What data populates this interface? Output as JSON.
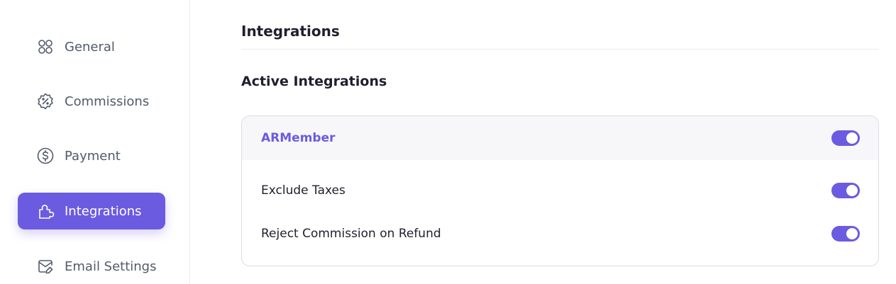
{
  "sidebar": {
    "items": [
      {
        "label": "General",
        "icon": "grid-circles-icon",
        "active": false
      },
      {
        "label": "Commissions",
        "icon": "percent-badge-icon",
        "active": false
      },
      {
        "label": "Payment",
        "icon": "dollar-circle-icon",
        "active": false
      },
      {
        "label": "Integrations",
        "icon": "puzzle-icon",
        "active": true
      },
      {
        "label": "Email Settings",
        "icon": "mail-edit-icon",
        "active": false
      }
    ]
  },
  "main": {
    "title": "Integrations",
    "section_title": "Active Integrations",
    "integration": {
      "name": "ARMember",
      "enabled": true,
      "options": [
        {
          "label": "Exclude Taxes",
          "enabled": true
        },
        {
          "label": "Reject Commission on Refund",
          "enabled": true
        }
      ]
    }
  },
  "colors": {
    "accent": "#6b5be0",
    "text": "#1f1f2e",
    "muted": "#525a6b",
    "border": "#dcdce4"
  }
}
